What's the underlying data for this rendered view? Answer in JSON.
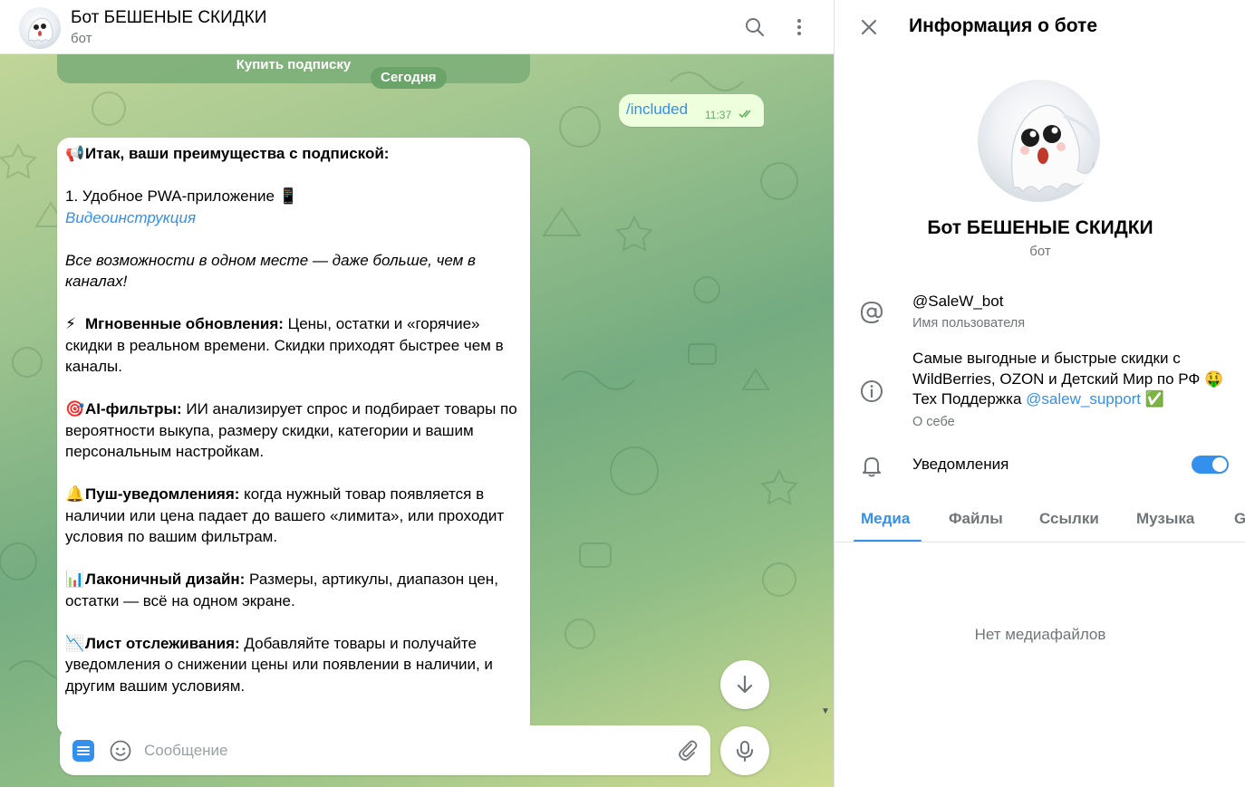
{
  "chat": {
    "title": "Бот БЕШЕНЫЕ СКИДКИ",
    "subtitle": "бот",
    "prev_button_label": "Купить подписку",
    "date_chip": "Сегодня",
    "outgoing": {
      "text": "/included",
      "time": "11:37"
    },
    "incoming": {
      "heading": "Итак, ваши преимущества с подпиской:",
      "item1_title": "1. Удобное PWA-приложение",
      "item1_link": "Видеоинструкция",
      "item1_italic": "Все возможности в одном месте — даже больше, чем в каналах!",
      "f1_title": "Мгновенные обновления:",
      "f1_text": " Цены, остатки и «горячие» скидки в реальном времени. Скидки приходят быстрее чем в каналы.",
      "f2_title": "AI-фильтры:",
      "f2_text": " ИИ анализирует спрос и подбирает товары по вероятности выкупа, размеру скидки, категории и вашим персональным настройкам.",
      "f3_title": "Пуш-уведомленияя:",
      "f3_text": " когда нужный товар появляется в наличии или цена падает до вашего «лимита», или проходит условия по вашим фильтрам.",
      "f4_title": "Лаконичный дизайн:",
      "f4_text": " Размеры, артикулы, диапазон цен, остатки — всё на одном экране.",
      "f5_title": "Лист отслеживания:",
      "f5_text": " Добавляйте товары и получайте уведомления о снижении цены или появлении в наличии, и другим вашим условиям."
    },
    "composer": {
      "placeholder": "Сообщение"
    }
  },
  "info": {
    "title": "Информация о боте",
    "name": "Бот БЕШЕНЫЕ СКИДКИ",
    "subtitle": "бот",
    "username": "@SaleW_bot",
    "username_label": "Имя пользователя",
    "about_text": "Самые выгодные и быстрые скидки с WildBerries, OZON и Детский Мир по РФ",
    "about_support": " Тех Поддержка ",
    "about_link": "@salew_support",
    "about_label": "О себе",
    "notifications_label": "Уведомления",
    "notifications_on": true,
    "tabs": [
      "Медиа",
      "Файлы",
      "Ссылки",
      "Музыка",
      "G"
    ],
    "active_tab": "Медиа",
    "empty_text": "Нет медиафайлов"
  },
  "colors": {
    "accent": "#3390ec",
    "outgoing_bg": "#eeffde",
    "chip": "#6aa469"
  }
}
